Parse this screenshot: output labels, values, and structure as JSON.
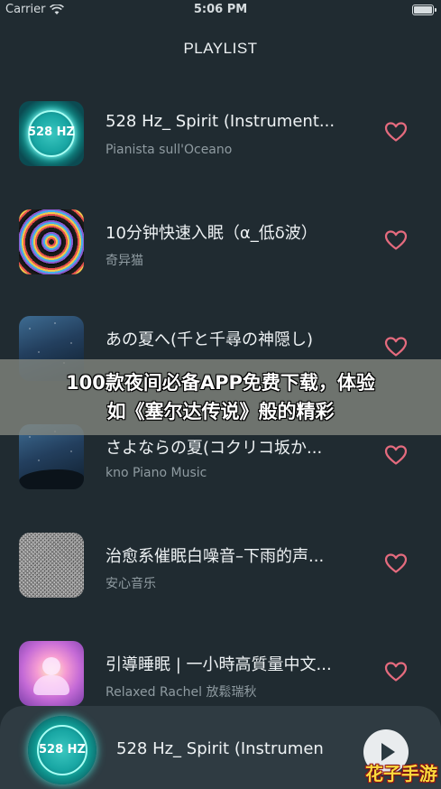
{
  "status_bar": {
    "carrier": "Carrier",
    "time": "5:06 PM"
  },
  "header": {
    "title": "PLAYLIST"
  },
  "tracks": [
    {
      "title": "528 Hz_ Spirit (Instrument...",
      "artist": "Pianista sull'Oceano",
      "thumb_label": "528 HZ"
    },
    {
      "title": "10分钟快速入眠（α_低δ波）",
      "artist": "奇异猫"
    },
    {
      "title": "あの夏へ(千と千尋の神隠し)",
      "artist": ""
    },
    {
      "title": "さよならの夏(コクリコ坂か...",
      "artist": "kno Piano Music"
    },
    {
      "title": "治愈系催眠白噪音–下雨的声...",
      "artist": "安心音乐"
    },
    {
      "title": "引導睡眠 | 一小時高質量中文...",
      "artist": "Relaxed Rachel 放鬆瑞秋"
    }
  ],
  "banner": {
    "line1": "100款夜间必备APP免费下载，体验",
    "line2": "如《塞尔达传说》般的精彩"
  },
  "now_playing": {
    "title": "528 Hz_ Spirit (Instrumen",
    "thumb_label": "528 HZ"
  },
  "watermark": "花子手游",
  "icons": {
    "wifi": "wifi-icon",
    "battery": "battery-icon",
    "favorite": "heart-outline-icon",
    "play": "play-icon"
  },
  "colors": {
    "background": "#202b31",
    "heart": "#e56b7e",
    "player_bar": "#2f3b42"
  }
}
